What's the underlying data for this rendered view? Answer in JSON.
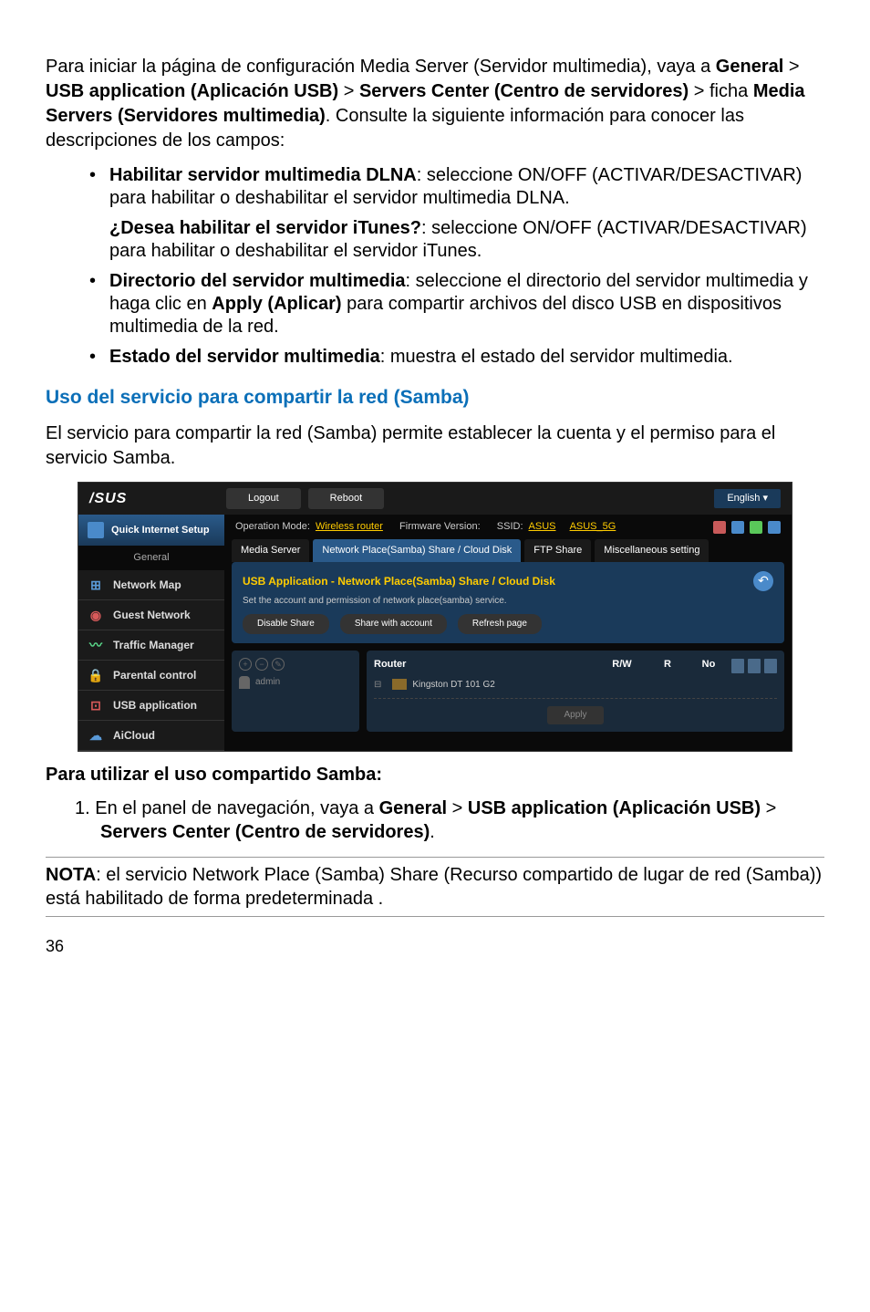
{
  "intro": {
    "line1a": "Para iniciar la página de configuración Media Server (Servidor multimedia), vaya a ",
    "general": "General",
    "gt1": " > ",
    "usbapp": "USB application (Aplicación USB)",
    "gt2": " > ",
    "servers": "Servers Center (Centro de servidores)",
    "gt3": " > ficha ",
    "media": "Media Servers (Servidores multimedia)",
    "tail": ". Consulte la siguiente información para conocer las descripciones de los campos:"
  },
  "bullets": [
    {
      "bold": "Habilitar servidor multimedia DLNA",
      "text": ": seleccione ON/OFF (ACTIVAR/DESACTIVAR) para habilitar o deshabilitar el servidor multimedia DLNA.",
      "nobullet": false
    },
    {
      "bold": "¿Desea habilitar el servidor iTunes?",
      "text": ": seleccione ON/OFF (ACTIVAR/DESACTIVAR) para habilitar o deshabilitar el servidor iTunes.",
      "nobullet": true
    },
    {
      "bold": "Directorio del servidor multimedia",
      "text": ": seleccione el directorio del servidor multimedia y haga clic en ",
      "bold2": "Apply (Aplicar)",
      "text2": " para compartir archivos del disco USB en dispositivos multimedia de la red.",
      "nobullet": false
    },
    {
      "bold": "Estado del servidor multimedia",
      "text": ": muestra el estado del servidor multimedia.",
      "nobullet": false
    }
  ],
  "heading": "Uso del servicio para compartir la red (Samba)",
  "heading_text": "El servicio para compartir la red (Samba) permite establecer la cuenta y el permiso para el servicio Samba.",
  "screenshot": {
    "logo": "/SUS",
    "logout": "Logout",
    "reboot": "Reboot",
    "english": "English",
    "qis": "Quick Internet Setup",
    "general": "General",
    "menu": [
      {
        "icon": "🖧",
        "label": "Network Map",
        "color": "#5a9ad8"
      },
      {
        "icon": "👥",
        "label": "Guest Network",
        "color": "#d85a5a"
      },
      {
        "icon": "📊",
        "label": "Traffic Manager",
        "color": "#5ad88a"
      },
      {
        "icon": "🔒",
        "label": "Parental control",
        "color": "#d8a85a"
      },
      {
        "icon": "🔌",
        "label": "USB application",
        "color": "#d85a5a"
      },
      {
        "icon": "☁",
        "label": "AiCloud",
        "color": "#5a9ad8"
      }
    ],
    "opmode": "Operation Mode: ",
    "opmode_link": "Wireless router",
    "firmware": "Firmware Version:",
    "ssid": "SSID: ",
    "ssid1": "ASUS",
    "ssid2": "ASUS_5G",
    "tabs": [
      "Media Server",
      "Network Place(Samba) Share / Cloud Disk",
      "FTP Share",
      "Miscellaneous setting"
    ],
    "panel_title": "USB Application - Network Place(Samba) Share / Cloud Disk",
    "panel_sub": "Set the account and permission of network place(samba) service.",
    "actions": [
      "Disable Share",
      "Share with account",
      "Refresh page"
    ],
    "admin": "admin",
    "router": "Router",
    "rw": "R/W",
    "r": "R",
    "no": "No",
    "row_label": "Kingston DT 101 G2",
    "apply": "Apply"
  },
  "subheading": "Para utilizar el uso compartido Samba:",
  "step1": {
    "num": "1. ",
    "text": "En el panel de navegación, vaya a ",
    "general": "General",
    "gt1": " > ",
    "usbapp": "USB application (Aplicación USB)",
    "gt2": " > ",
    "servers": "Servers Center (Centro de servidores)",
    "tail": "."
  },
  "note": {
    "bold": "NOTA",
    "text": ":  el servicio Network Place (Samba) Share (Recurso compartido de lugar de red (Samba)) está habilitado de forma predeterminada ."
  },
  "page": "36"
}
